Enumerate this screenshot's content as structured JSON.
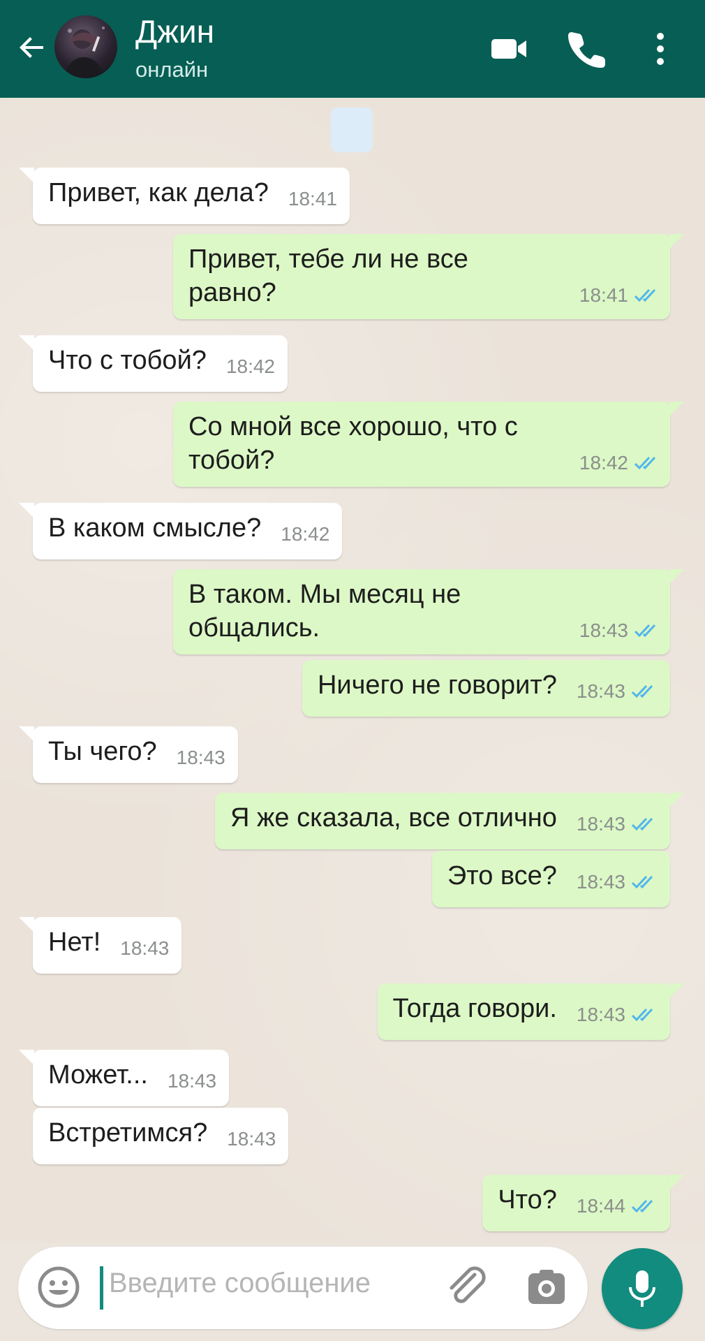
{
  "header": {
    "contact_name": "Джин",
    "status": "онлайн",
    "colors": {
      "bar": "#075e54",
      "status_text": "#d5ece9"
    }
  },
  "messages": [
    {
      "dir": "in",
      "text": "Привет, как дела?",
      "time": "18:41"
    },
    {
      "dir": "out",
      "text": "Привет, тебе ли не все\nравно?",
      "time": "18:41",
      "read": true
    },
    {
      "dir": "in",
      "text": "Что с тобой?",
      "time": "18:42"
    },
    {
      "dir": "out",
      "text": "Со мной все хорошо, что с\nтобой?",
      "time": "18:42",
      "read": true
    },
    {
      "dir": "in",
      "text": "В каком смысле?",
      "time": "18:42"
    },
    {
      "dir": "out",
      "text": "В таком. Мы месяц не\nобщались.",
      "time": "18:43",
      "read": true
    },
    {
      "dir": "out",
      "text": "Ничего не говорит?",
      "time": "18:43",
      "read": true
    },
    {
      "dir": "in",
      "text": "Ты чего?",
      "time": "18:43"
    },
    {
      "dir": "out",
      "text": "Я же сказала, все отлично",
      "time": "18:43",
      "read": true
    },
    {
      "dir": "out",
      "text": "Это все?",
      "time": "18:43",
      "read": true
    },
    {
      "dir": "in",
      "text": "Нет!",
      "time": "18:43"
    },
    {
      "dir": "out",
      "text": "Тогда говори.",
      "time": "18:43",
      "read": true
    },
    {
      "dir": "in",
      "text": "Может...",
      "time": "18:43"
    },
    {
      "dir": "in",
      "text": "Встретимся?",
      "time": "18:43"
    },
    {
      "dir": "out",
      "text": "Что?",
      "time": "18:44",
      "read": true
    }
  ],
  "composer": {
    "placeholder": "Введите сообщение"
  },
  "icons": {
    "back": "arrow-left-icon",
    "video": "video-camera-icon",
    "call": "phone-icon",
    "more": "more-vertical-icon",
    "emoji": "smiley-icon",
    "attach": "paperclip-icon",
    "camera": "camera-icon",
    "mic": "microphone-icon",
    "read_receipt": "double-check-icon"
  },
  "colors": {
    "incoming_bubble": "#ffffff",
    "outgoing_bubble": "#dcf8c6",
    "read_tick": "#4fb6ec",
    "mic_button": "#128c7e"
  }
}
